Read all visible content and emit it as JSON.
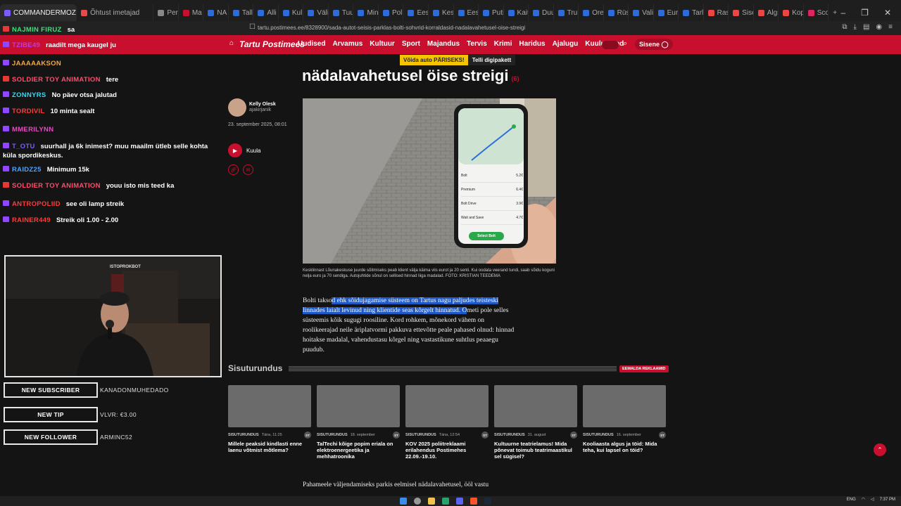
{
  "browser": {
    "tabs": [
      {
        "label": "COMMANDERMOZZIE",
        "color": "#7b5cff"
      },
      {
        "label": "Õhtust imetajad",
        "color": "#e84a4a"
      },
      {
        "label": "Per",
        "color": "#888"
      },
      {
        "label": "Ma",
        "color": "#c8102e"
      },
      {
        "label": "NA",
        "color": "#2d6bd8"
      },
      {
        "label": "Talli",
        "color": "#2d6bd8"
      },
      {
        "label": "Alli",
        "color": "#2d6bd8"
      },
      {
        "label": "Kul",
        "color": "#2d6bd8"
      },
      {
        "label": "Väli",
        "color": "#2d6bd8"
      },
      {
        "label": "Tuul",
        "color": "#2d6bd8"
      },
      {
        "label": "Min",
        "color": "#2d6bd8"
      },
      {
        "label": "Polii",
        "color": "#2d6bd8"
      },
      {
        "label": "Eest",
        "color": "#2d6bd8"
      },
      {
        "label": "Kesl",
        "color": "#2d6bd8"
      },
      {
        "label": "Eest",
        "color": "#2d6bd8"
      },
      {
        "label": "Puti",
        "color": "#2d6bd8"
      },
      {
        "label": "Kait",
        "color": "#2d6bd8"
      },
      {
        "label": "Duu",
        "color": "#2d6bd8"
      },
      {
        "label": "Trui",
        "color": "#2d6bd8"
      },
      {
        "label": "Orei",
        "color": "#2d6bd8"
      },
      {
        "label": "Rüs",
        "color": "#2d6bd8"
      },
      {
        "label": "Vali",
        "color": "#2d6bd8"
      },
      {
        "label": "Euro",
        "color": "#2d6bd8"
      },
      {
        "label": "Tarl",
        "color": "#2d6bd8"
      },
      {
        "label": "Ras",
        "color": "#e44"
      },
      {
        "label": "Sise",
        "color": "#e44"
      },
      {
        "label": "Algs",
        "color": "#e44"
      },
      {
        "label": "Kop",
        "color": "#e44"
      },
      {
        "label": "Sco",
        "color": "#e0245e"
      }
    ],
    "new_tab": "+",
    "url": "tartu.postimees.ee/8328900/sada-autot-seisis-parklas-bolti-sohvrid-korraldasid-nadalavahetusel-oise-streigi"
  },
  "site": {
    "logo": "Tartu Postimees",
    "nav": [
      "Uudised",
      "Arvamus",
      "Kultuur",
      "Sport",
      "Majandus",
      "Tervis",
      "Krimi",
      "Haridus",
      "Ajalugu",
      "Kuulutused"
    ],
    "login": "Sisene",
    "promo_yellow": "Võida auto PÄRISEKS!",
    "promo_dark": "Telli digipakett"
  },
  "article": {
    "title": "nädalavahetusel öise streigi",
    "comment_count": "(6)",
    "author_name": "Kelly Olesk",
    "author_role": "ajakirjanik",
    "date": "23. september 2025, 08:01",
    "listen": "Kuula",
    "caption": "Kesklinnast Lõunakeskuse juurde sõitmiseks peab klient välja käima viis eurot ja 20 senti. Kui oodata veerand tundi, saab sõidu koguni nelja euro ja 70 sendiga. Autojuhtide sõnul on sellised hinnad liiga madalad. FOTO: KRISTIAN TEEDEMA",
    "body_pre": "Bolti takso",
    "body_hl": "d ehk sõidujagamise süsteem on Tartus nagu paljudes teisteski linnades laialt levinud ning klientide seas kõrgelt hinnatud. O",
    "body_post": "meti pole selles süsteemis kõik sugugi roosiline. Kord rohkem, mõnekord vähem on roolikeerajad neile äriplatvormi pakkuva ettevõtte peale pahased olnud: hinnad hoitakse madalal, vahendustasu kõrgel ning vastastikune suhtlus peaaegu puudub.",
    "next_paragraph": "Pahameele väljendamiseks parkis eelmisel nädalavahetusel, ööl vastu"
  },
  "phone": {
    "options": [
      {
        "name": "Bolt",
        "price": "5.2€"
      },
      {
        "name": "Premium",
        "price": "6.4€"
      },
      {
        "name": "Bolt Drive",
        "price": "3.9€"
      },
      {
        "name": "Wait and Save",
        "price": "4.7€"
      }
    ],
    "select_button": "Select Bolt"
  },
  "sisuturundus": {
    "title": "Sisuturundus",
    "remove_ads": "EEMALDA REKLAAMID",
    "cards": [
      {
        "label": "SISUTURUNDUS",
        "date": "Täna, 11:25",
        "title": "Millele peaksid kindlasti enne laenu võtmist mõtlema?"
      },
      {
        "label": "SISUTURUNDUS",
        "date": "18. september",
        "title": "TalTechi kõige popim eriala on elektroenergeetika ja mehhatroonika"
      },
      {
        "label": "SISUTURUNDUS",
        "date": "Täna, 12:54",
        "title": "KOV 2025 poliitreklaami erilahendus Postimehes 22.09.-19.10."
      },
      {
        "label": "SISUTURUNDUS",
        "date": "31. august",
        "title": "Kultuurne teatrielamus! Mida põnevat toimub teatrimaastikul sel sügisel?"
      },
      {
        "label": "SISUTURUNDUS",
        "date": "16. september",
        "title": "Kooliaasta algus ja töid: Mida teha, kui lapsel on töid?"
      }
    ],
    "st_badge": "ST"
  },
  "stream": {
    "chat": [
      {
        "user": "NAJMIN FIRUZ",
        "msg": "sa",
        "ucolor": "#3ee07a",
        "icolor": "#e53935"
      },
      {
        "user": "TZIBE49",
        "msg": "raadilt mega kaugel ju",
        "ucolor": "#c03ae0",
        "icolor": "#9146ff"
      },
      {
        "user": "JAAAAAKSON",
        "msg": "",
        "ucolor": "#f4a742",
        "icolor": "#9146ff"
      },
      {
        "user": "SOLDIER TOY ANIMATION",
        "msg": "tere",
        "ucolor": "#ff4d6d",
        "icolor": "#e53935"
      },
      {
        "user": "ZONNYRS",
        "msg": "No päev otsa jalutad",
        "ucolor": "#38d6f0",
        "icolor": "#9146ff"
      },
      {
        "user": "TORDIVIL",
        "msg": "10 minta sealt",
        "ucolor": "#ff3b3b",
        "icolor": "#9146ff"
      },
      {
        "user": "MMERILYNN",
        "msg": "",
        "ucolor": "#e74bc2",
        "icolor": "#9146ff"
      },
      {
        "user": "T_OTU",
        "msg": "suurhall ja 6k inimest? muu maailm ütleb selle kohta küla spordikeskus.",
        "ucolor": "#7c5cff",
        "icolor": "#9146ff"
      },
      {
        "user": "RAIDZ25",
        "msg": "Minimum 15k",
        "ucolor": "#4aa3ff",
        "icolor": "#9146ff"
      },
      {
        "user": "SOLDIER TOY ANIMATION",
        "msg": "youu isto mis teed ka",
        "ucolor": "#ff4d6d",
        "icolor": "#e53935"
      },
      {
        "user": "ANTROPOLIID",
        "msg": "see oli lamp streik",
        "ucolor": "#ff3b3b",
        "icolor": "#9146ff"
      },
      {
        "user": "RAINER449",
        "msg": "Streik oli 1.00 - 2.00",
        "ucolor": "#ff3b3b",
        "icolor": "#9146ff"
      }
    ],
    "cam_label": "ISTOPROKBOT",
    "alerts": [
      {
        "label": "NEW SUBSCRIBER",
        "value": "KANADONMUHEDADO"
      },
      {
        "label": "NEW TIP",
        "value": "VLVR: €3.00"
      },
      {
        "label": "NEW FOLLOWER",
        "value": "ARMINC52"
      }
    ]
  },
  "taskbar": {
    "lang": "ENG",
    "time": "7:37 PM"
  }
}
